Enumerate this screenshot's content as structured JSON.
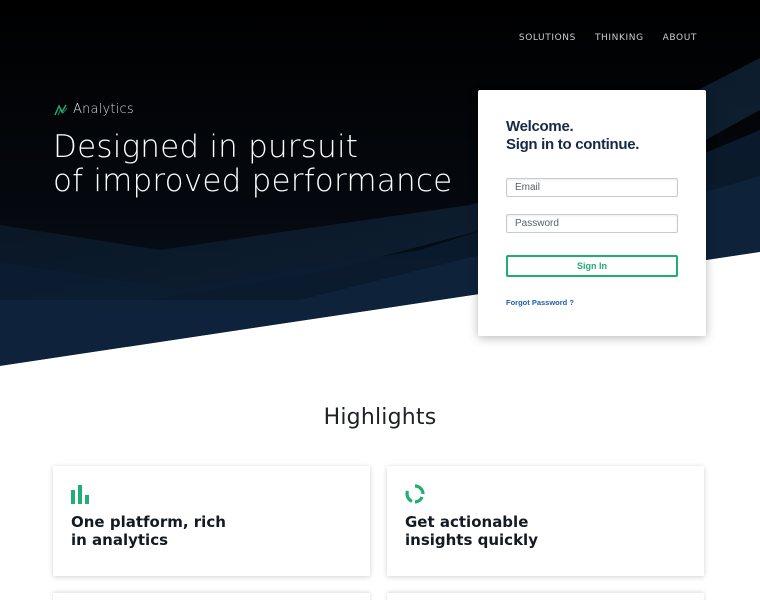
{
  "nav": {
    "items": [
      "SOLUTIONS",
      "THINKING",
      "ABOUT"
    ]
  },
  "brand": {
    "name": "Analytics",
    "logo_icon": "chevron-wave-logo-icon"
  },
  "hero": {
    "title_line1": "Designed in pursuit",
    "title_line2": "of improved performance"
  },
  "login": {
    "heading_line1": "Welcome.",
    "heading_line2": "Sign in to continue.",
    "email_placeholder": "Email",
    "password_placeholder": "Password",
    "signin_label": "Sign In",
    "forgot_label": "Forgot Password ?"
  },
  "highlights": {
    "title": "Highlights",
    "cards": [
      {
        "icon": "bar-chart-icon",
        "title_line1": "One platform, rich",
        "title_line2": "in analytics"
      },
      {
        "icon": "refresh-ring-icon",
        "title_line1": "Get actionable",
        "title_line2": "insights quickly"
      }
    ]
  },
  "colors": {
    "accent_green": "#1fae73",
    "hero_dark": "#05070b",
    "heading_navy": "#142a44",
    "link_blue": "#1d5ea8"
  }
}
